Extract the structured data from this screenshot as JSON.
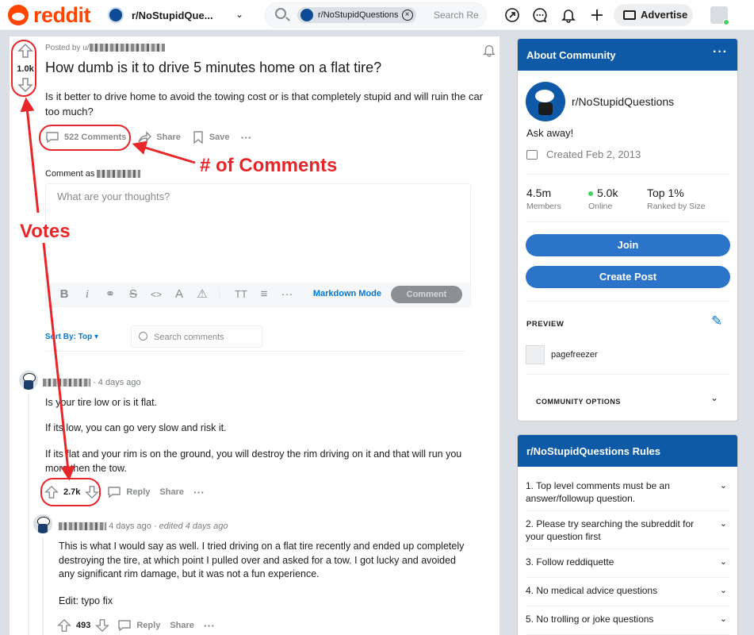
{
  "header": {
    "logo_text": "reddit",
    "subreddit": "r/NoStupidQue...",
    "search_chip": "r/NoStupidQuestions",
    "search_placeholder": "Search Re",
    "advertise": "Advertise"
  },
  "post": {
    "vote_count": "1.0k",
    "posted_by": "Posted by u/",
    "title": "How dumb is it to drive 5 minutes home on a flat tire?",
    "body": "Is it better to drive home to avoid the towing cost or is that completely stupid and will ruin the car too much?",
    "comments_label": "522 Comments",
    "share_label": "Share",
    "save_label": "Save",
    "more": "···"
  },
  "comment_box": {
    "comment_as": "Comment as",
    "placeholder": "What are your thoughts?",
    "markdown_mode": "Markdown Mode",
    "submit": "Comment"
  },
  "sort": {
    "label": "Sort By: Top",
    "search_placeholder": "Search comments"
  },
  "comments": [
    {
      "time": "· 4 days ago",
      "paragraphs": [
        "Is your tire low or is it flat.",
        "If its low, you can go very slow and risk it.",
        "If its flat and your rim is on the ground, you will destroy the rim driving on it and that will run you more then the tow."
      ],
      "votes": "2.7k",
      "reply": "Reply",
      "share": "Share"
    },
    {
      "time": "4 days ago",
      "edited": "· edited 4 days ago",
      "paragraphs": [
        "This is what I would say as well. I tried driving on a flat tire recently and ended up completely destroying the tire, at which point I pulled over and asked for a tow. I got lucky and avoided any significant rim damage, but it was not a fun experience.",
        "Edit: typo fix"
      ],
      "votes": "493",
      "reply": "Reply",
      "share": "Share"
    }
  ],
  "annotations": {
    "comments_note": "# of Comments",
    "votes_note": "Votes",
    "color": "#e8262a"
  },
  "about": {
    "header": "About Community",
    "name": "r/NoStupidQuestions",
    "description": "Ask away!",
    "created": "Created Feb 2, 2013",
    "members_value": "4.5m",
    "members_label": "Members",
    "online_value": "5.0k",
    "online_label": "Online",
    "rank_value": "Top 1%",
    "rank_label": "Ranked by Size",
    "join": "Join",
    "create_post": "Create Post",
    "preview_label": "PREVIEW",
    "preview_user": "pagefreezer",
    "community_options": "COMMUNITY OPTIONS"
  },
  "rules": {
    "header": "r/NoStupidQuestions Rules",
    "items": [
      "1. Top level comments must be an answer/followup question.",
      "2. Please try searching the subreddit for your question first",
      "3. Follow reddiquette",
      "4. No medical advice questions",
      "5. No trolling or joke questions"
    ]
  },
  "colors": {
    "brand": "#ff4500",
    "header_blue": "#0e5aa7",
    "button_blue": "#2c74c9",
    "link_blue": "#0079d3"
  }
}
